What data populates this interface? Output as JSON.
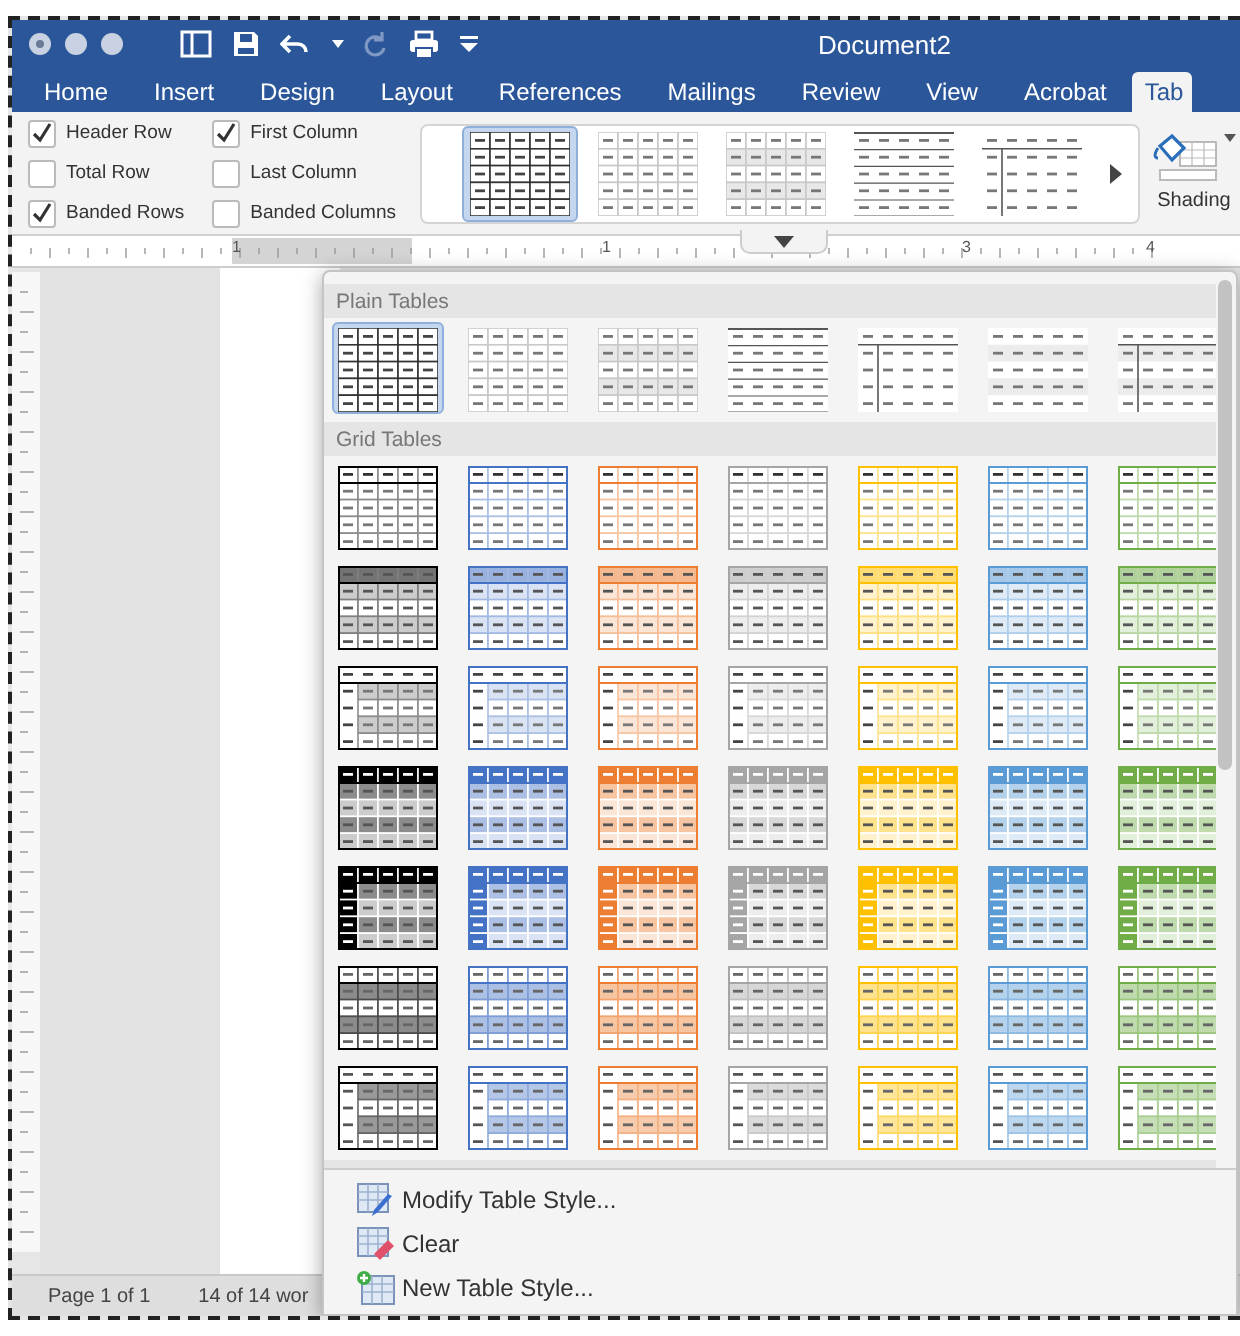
{
  "window": {
    "title": "Document2"
  },
  "tabs": [
    {
      "label": "Home",
      "selected": false
    },
    {
      "label": "Insert",
      "selected": false
    },
    {
      "label": "Design",
      "selected": false
    },
    {
      "label": "Layout",
      "selected": false
    },
    {
      "label": "References",
      "selected": false
    },
    {
      "label": "Mailings",
      "selected": false
    },
    {
      "label": "Review",
      "selected": false
    },
    {
      "label": "View",
      "selected": false
    },
    {
      "label": "Acrobat",
      "selected": false
    },
    {
      "label": "Tab",
      "selected": true
    }
  ],
  "table_options": [
    {
      "label": "Header Row",
      "checked": true
    },
    {
      "label": "Total Row",
      "checked": false
    },
    {
      "label": "Banded Rows",
      "checked": true
    },
    {
      "label": "First Column",
      "checked": true
    },
    {
      "label": "Last Column",
      "checked": false
    },
    {
      "label": "Banded Columns",
      "checked": false
    }
  ],
  "ribbon_styles": [
    {
      "kind": "plain-grid",
      "selected": true
    },
    {
      "kind": "plain-light-grid",
      "selected": false
    },
    {
      "kind": "plain-banded",
      "selected": false
    },
    {
      "kind": "plain-lines",
      "selected": false
    },
    {
      "kind": "plain-first-col",
      "selected": false
    }
  ],
  "shading": {
    "label": "Shading"
  },
  "ruler": {
    "labels": [
      "1",
      "1",
      "3",
      "4"
    ]
  },
  "status_bar": {
    "page": "Page 1 of 1",
    "words": "14 of 14 wor"
  },
  "gallery": {
    "sections": [
      {
        "title": "Plain Tables",
        "rows": [
          [
            {
              "kind": "plain-grid",
              "selected": true
            },
            {
              "kind": "plain-light-grid",
              "selected": false
            },
            {
              "kind": "plain-banded",
              "selected": false
            },
            {
              "kind": "plain-lines",
              "selected": false
            },
            {
              "kind": "plain-first-col",
              "selected": false
            },
            {
              "kind": "plain-banded-open",
              "selected": false
            },
            {
              "kind": "plain-first-col-banded",
              "selected": false
            }
          ]
        ]
      },
      {
        "title": "Grid Tables",
        "rows": [
          [
            {
              "kind": "grid-light",
              "color": "#000000",
              "selected": false
            },
            {
              "kind": "grid-light",
              "color": "#4472c4",
              "selected": false
            },
            {
              "kind": "grid-light",
              "color": "#ed7d31",
              "selected": false
            },
            {
              "kind": "grid-light",
              "color": "#a5a5a5",
              "selected": false
            },
            {
              "kind": "grid-light",
              "color": "#ffc000",
              "selected": false
            },
            {
              "kind": "grid-light",
              "color": "#5b9bd5",
              "selected": false
            },
            {
              "kind": "grid-light",
              "color": "#70ad47",
              "selected": false
            }
          ],
          [
            {
              "kind": "grid-banded",
              "color": "#000000",
              "selected": false
            },
            {
              "kind": "grid-banded",
              "color": "#4472c4",
              "selected": false
            },
            {
              "kind": "grid-banded",
              "color": "#ed7d31",
              "selected": false
            },
            {
              "kind": "grid-banded",
              "color": "#a5a5a5",
              "selected": false
            },
            {
              "kind": "grid-banded",
              "color": "#ffc000",
              "selected": false
            },
            {
              "kind": "grid-banded",
              "color": "#5b9bd5",
              "selected": false
            },
            {
              "kind": "grid-banded",
              "color": "#70ad47",
              "selected": false
            }
          ],
          [
            {
              "kind": "grid-header",
              "color": "#000000",
              "selected": false
            },
            {
              "kind": "grid-header",
              "color": "#4472c4",
              "selected": false
            },
            {
              "kind": "grid-header",
              "color": "#ed7d31",
              "selected": false
            },
            {
              "kind": "grid-header",
              "color": "#a5a5a5",
              "selected": false
            },
            {
              "kind": "grid-header",
              "color": "#ffc000",
              "selected": false
            },
            {
              "kind": "grid-header",
              "color": "#5b9bd5",
              "selected": false
            },
            {
              "kind": "grid-header",
              "color": "#70ad47",
              "selected": false
            }
          ],
          [
            {
              "kind": "grid-accent-header",
              "color": "#000000",
              "selected": false
            },
            {
              "kind": "grid-accent-header",
              "color": "#4472c4",
              "selected": false
            },
            {
              "kind": "grid-accent-header",
              "color": "#ed7d31",
              "selected": false
            },
            {
              "kind": "grid-accent-header",
              "color": "#a5a5a5",
              "selected": false
            },
            {
              "kind": "grid-accent-header",
              "color": "#ffc000",
              "selected": false
            },
            {
              "kind": "grid-accent-header",
              "color": "#5b9bd5",
              "selected": false
            },
            {
              "kind": "grid-accent-header",
              "color": "#70ad47",
              "selected": false
            }
          ],
          [
            {
              "kind": "grid-accent",
              "color": "#000000",
              "selected": false
            },
            {
              "kind": "grid-accent",
              "color": "#4472c4",
              "selected": false
            },
            {
              "kind": "grid-accent",
              "color": "#ed7d31",
              "selected": false
            },
            {
              "kind": "grid-accent",
              "color": "#a5a5a5",
              "selected": false
            },
            {
              "kind": "grid-accent",
              "color": "#ffc000",
              "selected": false
            },
            {
              "kind": "grid-accent",
              "color": "#5b9bd5",
              "selected": false
            },
            {
              "kind": "grid-accent",
              "color": "#70ad47",
              "selected": false
            }
          ],
          [
            {
              "kind": "grid-bordered",
              "color": "#000000",
              "selected": false
            },
            {
              "kind": "grid-bordered",
              "color": "#4472c4",
              "selected": false
            },
            {
              "kind": "grid-bordered",
              "color": "#ed7d31",
              "selected": false
            },
            {
              "kind": "grid-bordered",
              "color": "#a5a5a5",
              "selected": false
            },
            {
              "kind": "grid-bordered",
              "color": "#ffc000",
              "selected": false
            },
            {
              "kind": "grid-bordered",
              "color": "#5b9bd5",
              "selected": false
            },
            {
              "kind": "grid-bordered",
              "color": "#70ad47",
              "selected": false
            }
          ],
          [
            {
              "kind": "grid-first-col",
              "color": "#000000",
              "selected": false
            },
            {
              "kind": "grid-first-col",
              "color": "#4472c4",
              "selected": false
            },
            {
              "kind": "grid-first-col",
              "color": "#ed7d31",
              "selected": false
            },
            {
              "kind": "grid-first-col",
              "color": "#a5a5a5",
              "selected": false
            },
            {
              "kind": "grid-first-col",
              "color": "#ffc000",
              "selected": false
            },
            {
              "kind": "grid-first-col",
              "color": "#5b9bd5",
              "selected": false
            },
            {
              "kind": "grid-first-col",
              "color": "#70ad47",
              "selected": false
            }
          ]
        ]
      }
    ]
  },
  "menu": [
    {
      "kind": "modify",
      "label": "Modify Table Style..."
    },
    {
      "kind": "clear",
      "label": "Clear"
    },
    {
      "kind": "new",
      "label": "New Table Style..."
    }
  ]
}
